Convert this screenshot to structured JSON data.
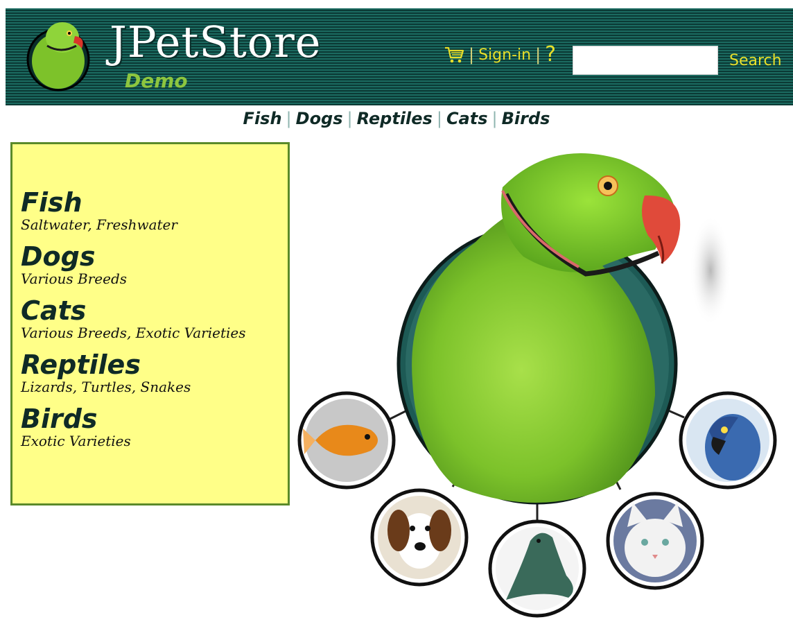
{
  "header": {
    "logo_title": "JPetStore",
    "logo_subtitle": "Demo",
    "signin_label": "Sign-in",
    "help_label": "?",
    "search_button": "Search",
    "search_value": "",
    "colors": {
      "header_bg": "#0f4a44",
      "link": "#e8df2a",
      "subtitle": "#8dc63f"
    }
  },
  "quicknav": {
    "items": [
      "Fish",
      "Dogs",
      "Reptiles",
      "Cats",
      "Birds"
    ],
    "separator": "|"
  },
  "sidebar": {
    "categories": [
      {
        "name": "Fish",
        "desc": "Saltwater, Freshwater"
      },
      {
        "name": "Dogs",
        "desc": "Various Breeds"
      },
      {
        "name": "Cats",
        "desc": "Various Breeds, Exotic Varieties"
      },
      {
        "name": "Reptiles",
        "desc": "Lizards, Turtles, Snakes"
      },
      {
        "name": "Birds",
        "desc": "Exotic Varieties"
      }
    ],
    "colors": {
      "bg": "#ffff88",
      "border": "#5a8a2a"
    }
  },
  "splash": {
    "hotspots": [
      "fish-circle",
      "dog-circle",
      "reptile-circle",
      "cat-circle",
      "bird-circle"
    ]
  }
}
